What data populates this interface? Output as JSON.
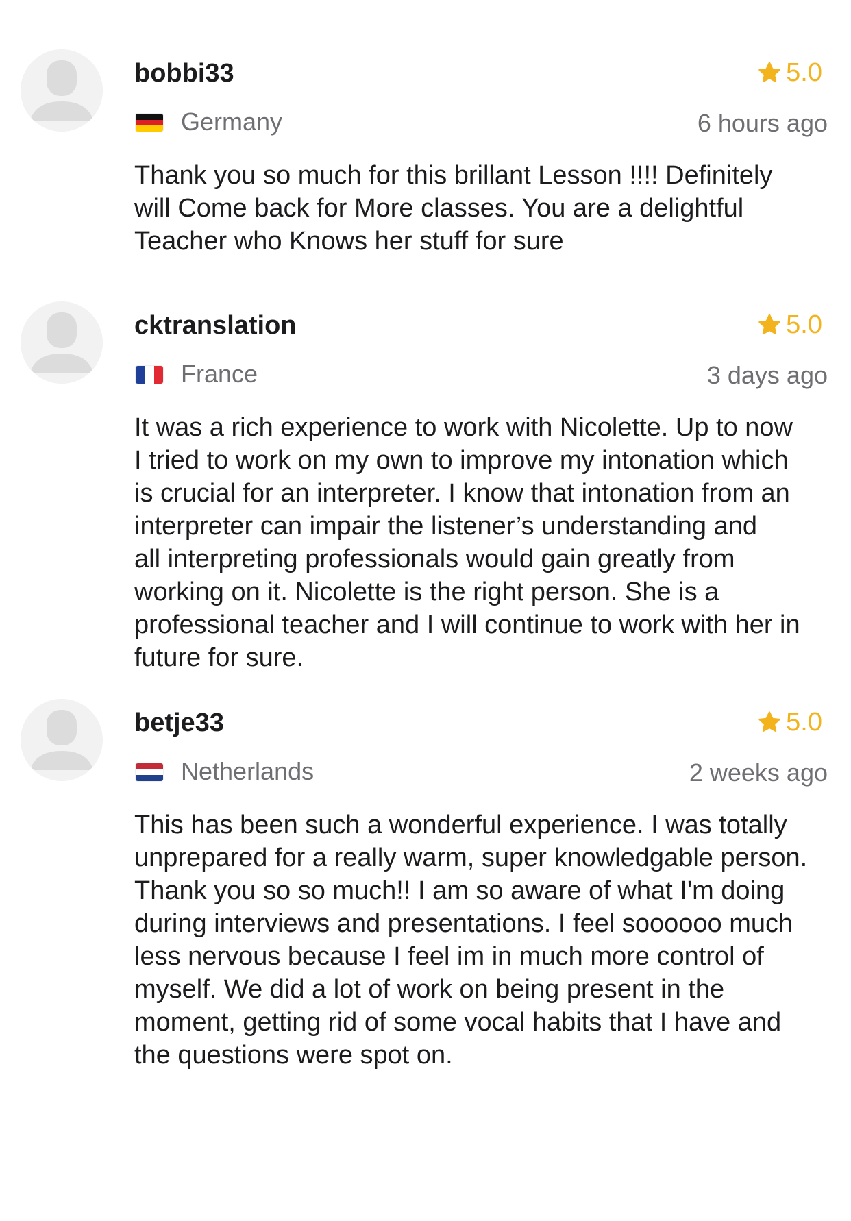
{
  "colors": {
    "rating_accent": "#f2b31c",
    "secondary_text": "#6e6e73",
    "primary_text": "#1c1c1e",
    "avatar_bg": "#f2f2f2"
  },
  "reviews": [
    {
      "username": "bobbi33",
      "rating": "5.0",
      "country": "Germany",
      "flag_icon": "germany-flag-icon",
      "time": "6 hours ago",
      "text": "Thank you so much for this brillant Lesson !!!! Definitely\nwill Come back for More classes. You are a delightful\nTeacher who Knows her stuff for sure"
    },
    {
      "username": "cktranslation",
      "rating": "5.0",
      "country": "France",
      "flag_icon": "france-flag-icon",
      "time": "3 days ago",
      "text": "It was a rich experience to work with Nicolette. Up to now\nI tried to work on my own to improve my intonation which\nis crucial for an interpreter. I know that intonation from an\ninterpreter can impair the listener’s understanding and\nall interpreting professionals would gain greatly from\nworking on it. Nicolette is the right person. She is a\nprofessional teacher and I will continue to work with her in\nfuture for sure."
    },
    {
      "username": "betje33",
      "rating": "5.0",
      "country": "Netherlands",
      "flag_icon": "netherlands-flag-icon",
      "time": "2 weeks ago",
      "text": "This has been such a wonderful experience. I was totally\nunprepared for a really warm, super knowledgable person.\nThank you so so much!! I am so aware of what I'm doing\nduring interviews and presentations. I feel soooooo much\nless nervous because I feel im in much more control of\nmyself. We did a lot of work on being present in the\nmoment, getting rid of some vocal habits that I have and\nthe questions were spot on."
    }
  ]
}
